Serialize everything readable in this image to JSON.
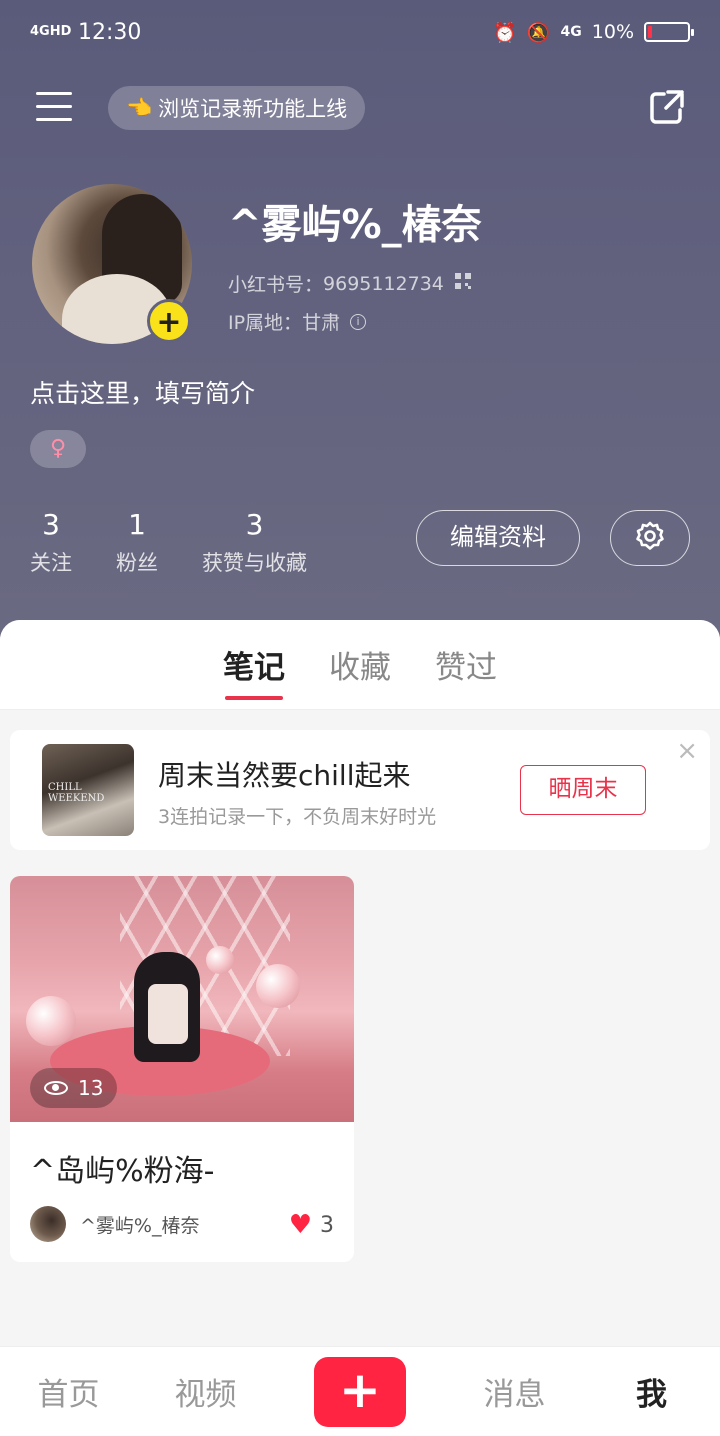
{
  "status_bar": {
    "network": "4GHD",
    "time": "12:30",
    "cell": "4G",
    "battery_text": "10%",
    "battery_level": 0.1
  },
  "header": {
    "notice": "浏览记录新功能上线",
    "notice_emoji": "👈"
  },
  "profile": {
    "username": "^雾屿%_椿奈",
    "id_label": "小红书号：",
    "id_value": "9695112734",
    "ip_label": "IP属地：",
    "ip_value": "甘肃",
    "bio": "点击这里，填写简介",
    "gender_symbol": "♀"
  },
  "stats": [
    {
      "num": "3",
      "label": "关注"
    },
    {
      "num": "1",
      "label": "粉丝"
    },
    {
      "num": "3",
      "label": "获赞与收藏"
    }
  ],
  "actions": {
    "edit": "编辑资料"
  },
  "tabs": [
    "笔记",
    "收藏",
    "赞过"
  ],
  "promo": {
    "title": "周末当然要chill起来",
    "subtitle": "3连拍记录一下，不负周末好时光",
    "button": "晒周末",
    "thumb_text": "CHILL WEEKEND"
  },
  "note": {
    "views": "13",
    "title": "^岛屿%粉海-",
    "author": "^雾屿%_椿奈",
    "likes": "3"
  },
  "bottom_nav": {
    "home": "首页",
    "video": "视频",
    "plus": "+",
    "messages": "消息",
    "me": "我"
  },
  "colors": {
    "accent": "#ff2442",
    "header_bg": "#5f5f7c",
    "avatar_badge": "#f9e219"
  }
}
